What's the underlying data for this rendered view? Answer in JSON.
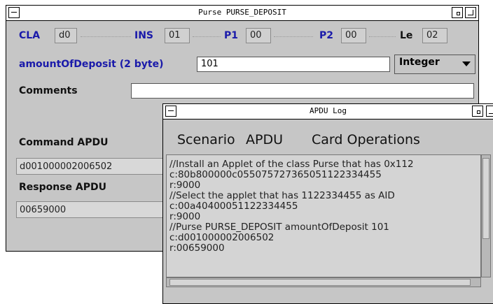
{
  "main_window": {
    "title": "Purse PURSE_DEPOSIT",
    "header": {
      "cla_label": "CLA",
      "cla_value": "d0",
      "ins_label": "INS",
      "ins_value": "01",
      "p1_label": "P1",
      "p1_value": "00",
      "p2_label": "P2",
      "p2_value": "00",
      "le_label": "Le",
      "le_value": "02"
    },
    "amount_label": "amountOfDeposit (2 byte)",
    "amount_value": "101",
    "type_selected": "Integer",
    "comments_label": "Comments",
    "comments_value": "",
    "command_apdu_label": "Command APDU",
    "command_apdu_value": "d001000002006502",
    "response_apdu_label": "Response APDU",
    "response_apdu_value": "00659000"
  },
  "log_window": {
    "title": "APDU Log",
    "menu": [
      "Scenario",
      "APDU",
      "Card Operations"
    ],
    "lines": [
      "//Install an Applet of the class Purse that has 0x112",
      "c:80b800000c055075727365051122334455",
      "r:9000",
      "//Select the applet that has 1122334455 as AID",
      "c:00a40400051122334455",
      "r:9000",
      "//Purse PURSE_DEPOSIT amountOfDeposit 101",
      "c:d001000002006502",
      "r:00659000"
    ]
  },
  "colors": {
    "label_blue": "#1a1aaa",
    "window_bg": "#c6c6c6"
  }
}
